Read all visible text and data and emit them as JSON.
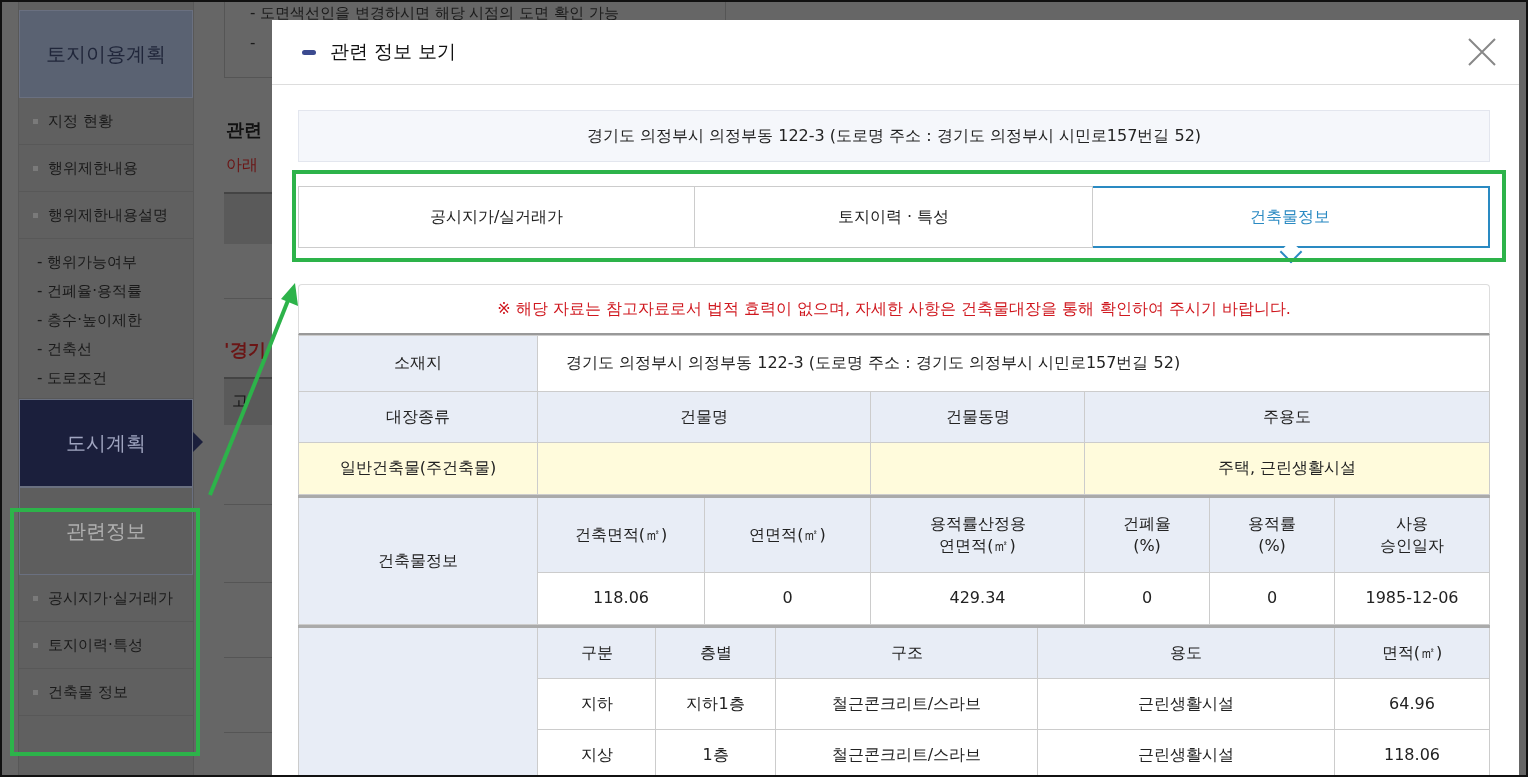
{
  "background_page": {
    "notice_lines": [
      "- 도면색선인을 변경하시면 해당 시점의 도면 확인 가능",
      "-"
    ],
    "heading": "관련",
    "red_text": "아래",
    "red_heading": "'경기",
    "table_cell": "고"
  },
  "sidebar": {
    "sections": [
      {
        "title": "토지이용계획",
        "selected": false,
        "color": "#5a6272",
        "items": [
          {
            "label": "지정 현황",
            "kind": "bullet"
          },
          {
            "label": "행위제한내용",
            "kind": "bullet"
          },
          {
            "label": "행위제한내용설명",
            "kind": "bullet"
          },
          {
            "label": "- 행위가능여부",
            "kind": "dash"
          },
          {
            "label": "- 건폐율·용적률",
            "kind": "dash"
          },
          {
            "label": "- 층수·높이제한",
            "kind": "dash"
          },
          {
            "label": "- 건축선",
            "kind": "dash"
          },
          {
            "label": "- 도로조건",
            "kind": "dash"
          }
        ]
      },
      {
        "title": "도시계획",
        "selected": true,
        "color": "#1b1f3c"
      },
      {
        "title": "관련정보",
        "selected": false,
        "color": "#5e5e5e",
        "items": [
          {
            "label": "공시지가·실거래가",
            "kind": "bullet"
          },
          {
            "label": "토지이력·특성",
            "kind": "bullet"
          },
          {
            "label": "건축물 정보",
            "kind": "bullet"
          }
        ]
      }
    ]
  },
  "modal": {
    "title": "관련 정보 보기",
    "address": "경기도 의정부시 의정부동 122-3 (도로명 주소 : 경기도 의정부시 시민로157번길 52)",
    "tabs": [
      {
        "label": "공시지가/실거래가",
        "selected": false
      },
      {
        "label": "토지이력 · 특성",
        "selected": false
      },
      {
        "label": "건축물정보",
        "selected": true
      }
    ],
    "notice": "※ 해당 자료는 참고자료로서 법적 효력이 없으며, 자세한 사항은 건축물대장을 통해 확인하여 주시기 바랍니다.",
    "location": {
      "label": "소재지",
      "value": "경기도 의정부시 의정부동 122-3 (도로명 주소 : 경기도 의정부시 시민로157번길 52)"
    },
    "register": {
      "columns": [
        "대장종류",
        "건물명",
        "건물동명",
        "주용도"
      ],
      "row": [
        {
          "kind": "text",
          "text": "일반건축물(주건축물)"
        },
        {
          "kind": "blank"
        },
        {
          "kind": "blank"
        },
        {
          "kind": "text",
          "text": "주택, 근린생활시설"
        }
      ]
    },
    "building_info": {
      "label": "건축물정보",
      "columns": [
        "건축면적(㎡)",
        "연면적(㎡)",
        "용적률산정용\n연면적(㎡)",
        "건폐율\n(%)",
        "용적률\n(%)",
        "사용\n승인일자"
      ],
      "values": [
        "118.06",
        "0",
        "429.34",
        "0",
        "0",
        "1985-12-06"
      ]
    },
    "floors": {
      "columns": [
        "구분",
        "층별",
        "구조",
        "용도",
        "면적(㎡)"
      ],
      "rows": [
        [
          "지하",
          "지하1층",
          "철근콘크리트/스라브",
          "근린생활시설",
          "64.96"
        ],
        [
          "지상",
          "1층",
          "철근콘크리트/스라브",
          "근린생활시설",
          "118.06"
        ]
      ]
    }
  }
}
